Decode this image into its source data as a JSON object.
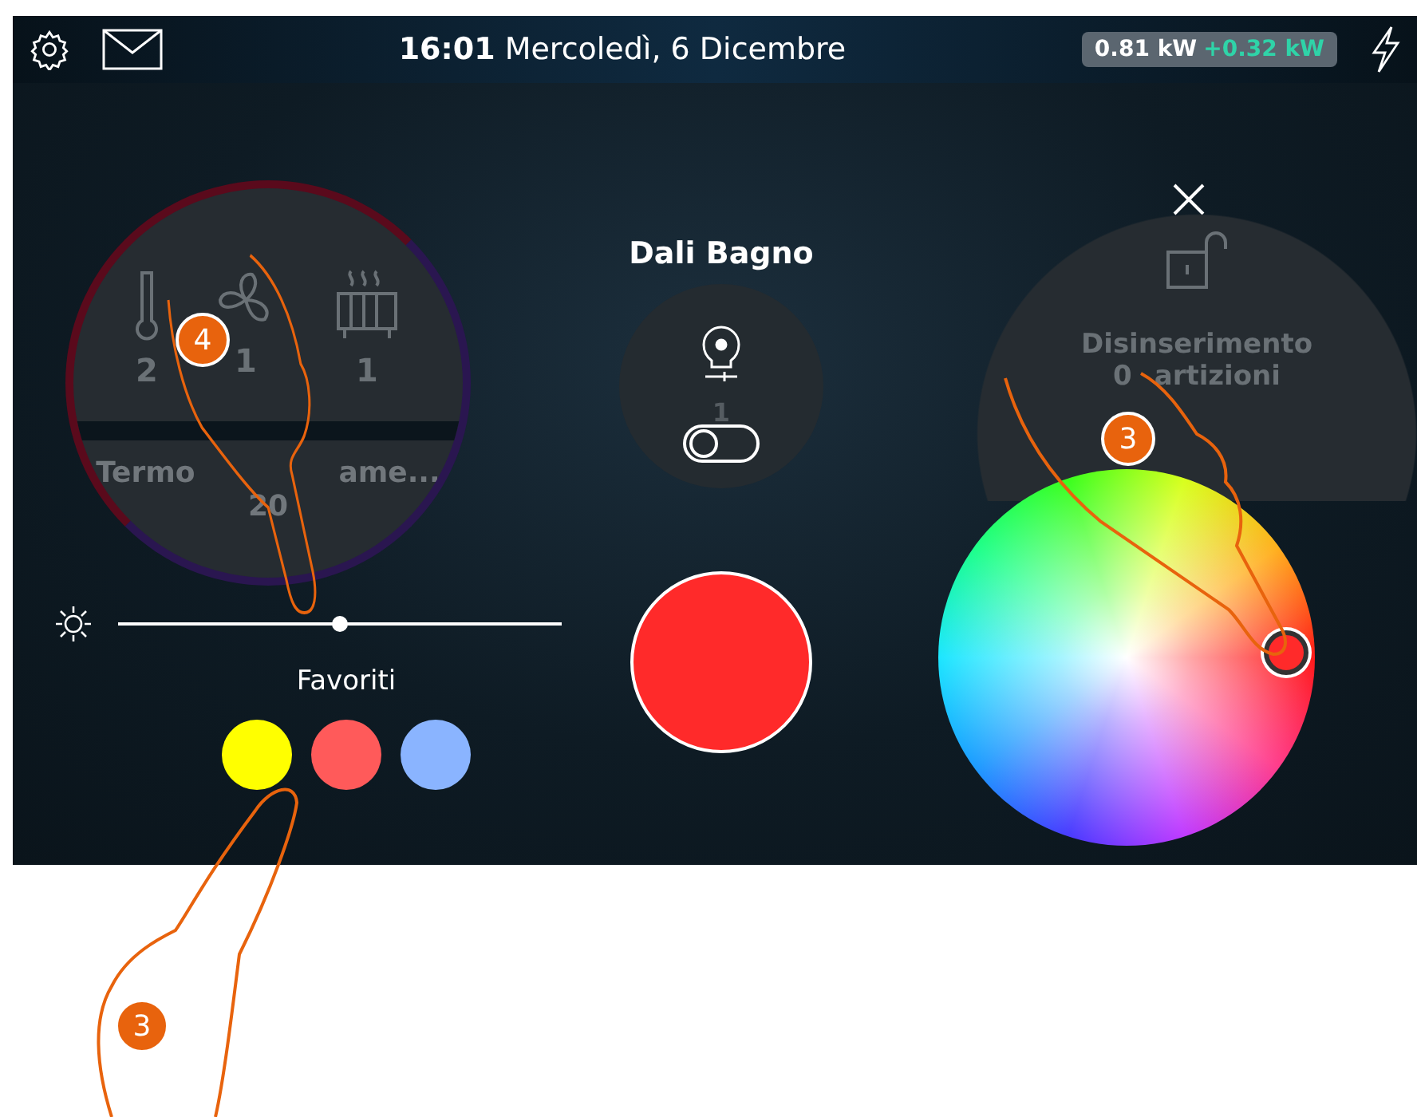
{
  "status_bar": {
    "time": "16:01",
    "date": "Mercoledì, 6 Dicembre",
    "power": "0.81 kW",
    "power_delta": "+0.32 kW"
  },
  "climate_widget": {
    "counts": [
      {
        "kind": "thermometer",
        "count": "2"
      },
      {
        "kind": "fan",
        "count": "1"
      },
      {
        "kind": "radiator",
        "count": "1"
      }
    ],
    "title_parts": [
      "Termo",
      "ame..."
    ],
    "value": "20"
  },
  "brightness": {
    "level": 0.5
  },
  "favorites": {
    "label": "Favoriti",
    "colors": [
      {
        "color": "#ffff00"
      },
      {
        "color": "#ff5a5a"
      },
      {
        "color": "#8ab4ff"
      }
    ]
  },
  "light": {
    "title": "Dali Bagno",
    "count": "1",
    "on": false,
    "color": "#ff2a2a"
  },
  "alarm_widget": {
    "line_1": "Disinserimento",
    "line_2_parts": [
      "0",
      "artizioni"
    ]
  },
  "color_wheel": {
    "handle": {
      "color": "#ff2a2a"
    }
  },
  "steps": [
    {
      "number": "4"
    },
    {
      "number": "3"
    },
    {
      "number": "3"
    }
  ]
}
